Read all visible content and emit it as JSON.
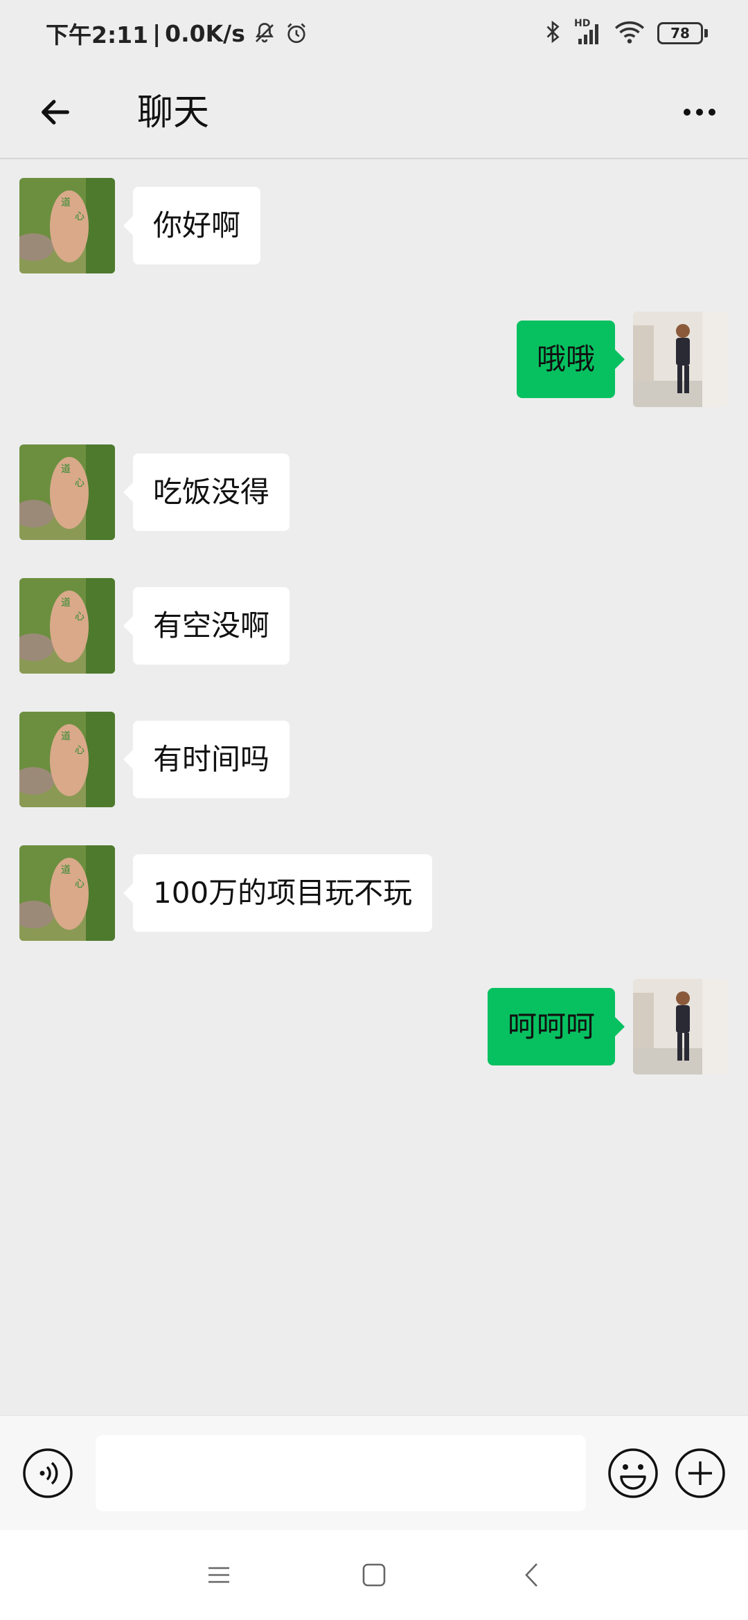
{
  "status_bar": {
    "time": "下午2:11",
    "separator": "|",
    "network_speed": "0.0K/s",
    "battery": "78",
    "signal_label": "HD",
    "icons": [
      "mute-icon",
      "alarm-icon",
      "bluetooth-icon",
      "signal-icon",
      "wifi-icon",
      "battery-icon"
    ]
  },
  "header": {
    "title": "聊天",
    "back_icon": "arrow-left-icon",
    "more_icon": "more-dots-icon"
  },
  "messages": [
    {
      "side": "left",
      "text": "你好啊",
      "avatar": "rock-avatar"
    },
    {
      "side": "right",
      "text": "哦哦",
      "avatar": "user-photo-avatar"
    },
    {
      "side": "left",
      "text": "吃饭没得",
      "avatar": "rock-avatar"
    },
    {
      "side": "left",
      "text": "有空没啊",
      "avatar": "rock-avatar"
    },
    {
      "side": "left",
      "text": "有时间吗",
      "avatar": "rock-avatar"
    },
    {
      "side": "left",
      "text": "100万的项目玩不玩",
      "avatar": "rock-avatar"
    },
    {
      "side": "right",
      "text": "呵呵呵",
      "avatar": "user-photo-avatar"
    }
  ],
  "input_bar": {
    "value": "",
    "icons": [
      "voice-icon",
      "emoji-icon",
      "plus-icon"
    ]
  },
  "nav_bar": {
    "icons": [
      "menu-icon",
      "home-icon",
      "back-icon"
    ]
  },
  "colors": {
    "background": "#ededed",
    "sent_bubble": "#07c160",
    "received_bubble": "#ffffff"
  }
}
